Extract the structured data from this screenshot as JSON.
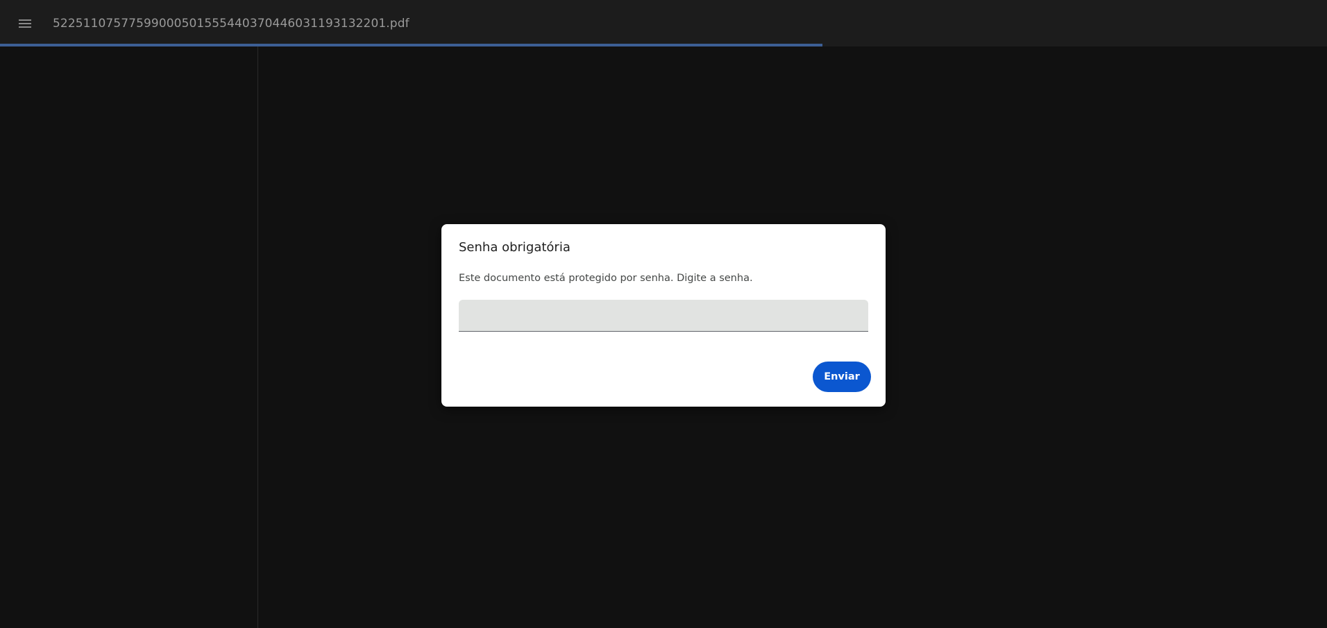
{
  "toolbar": {
    "menu_icon": "hamburger-menu-icon",
    "document_title": "52251107577599000501555440370446031193132201.pdf",
    "load_progress": 0.62,
    "progress_color": "#3d5f95"
  },
  "dialog": {
    "title": "Senha obrigatória",
    "message": "Este documento está protegido por senha. Digite a senha.",
    "password_value": "",
    "submit_label": "Enviar",
    "accent_color": "#0b57d0"
  }
}
